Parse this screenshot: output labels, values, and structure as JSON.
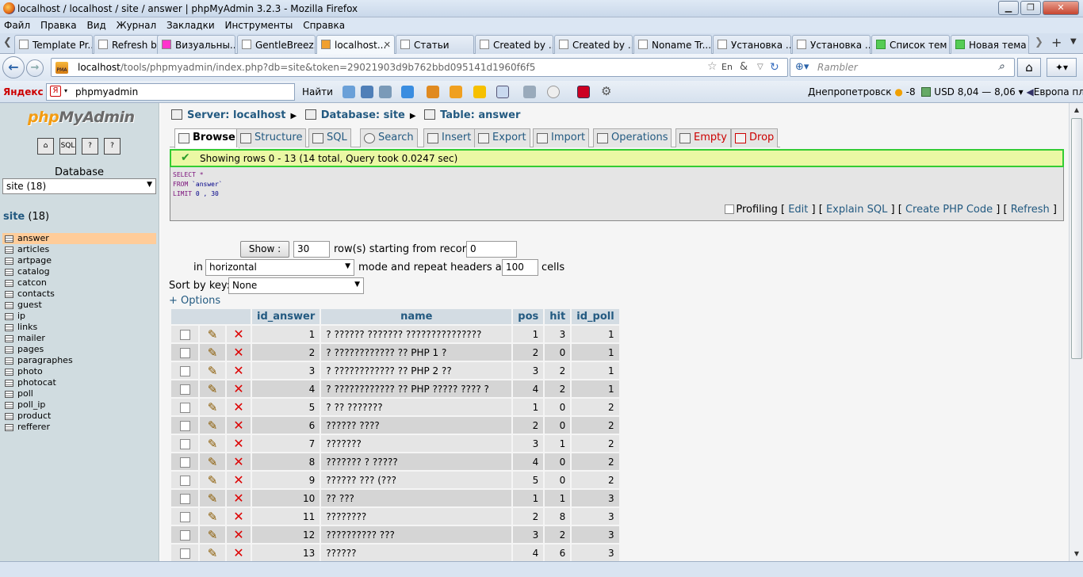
{
  "window": {
    "title": "localhost / localhost / site / answer | phpMyAdmin 3.2.3 - Mozilla Firefox"
  },
  "menu": [
    "Файл",
    "Правка",
    "Вид",
    "Журнал",
    "Закладки",
    "Инструменты",
    "Справка"
  ],
  "tabs": [
    {
      "label": "Template Pr..."
    },
    {
      "label": "Refresh by F..."
    },
    {
      "label": "Визуальны..."
    },
    {
      "label": "GentleBreez..."
    },
    {
      "label": "localhost..."
    },
    {
      "label": "Статьи"
    },
    {
      "label": "Created by ..."
    },
    {
      "label": "Created by ..."
    },
    {
      "label": "Noname Tr..."
    },
    {
      "label": "Установка ..."
    },
    {
      "label": "Установка ..."
    },
    {
      "label": "Список тем"
    },
    {
      "label": "Новая тема"
    }
  ],
  "nav": {
    "url_host": "localhost",
    "url_rest": "/tools/phpmyadmin/index.php?db=site&token=29021903d9b762bbd095141d1960f6f5",
    "search_placeholder": "Rambler"
  },
  "yandex": {
    "logo": "Яндекс",
    "search_value": "phpmyadmin",
    "find_label": "Найти",
    "city": "Днепропетровск",
    "temp": "-8",
    "usd": "USD 8,04 — 8,06",
    "radio": "Европа плюс"
  },
  "sidebar": {
    "logo_php": "php",
    "logo_my": "MyAdmin",
    "database_label": "Database",
    "db_select": "site (18)",
    "db_name": "site",
    "db_count": "(18)",
    "tables": [
      "answer",
      "articles",
      "artpage",
      "catalog",
      "catcon",
      "contacts",
      "guest",
      "ip",
      "links",
      "mailer",
      "pages",
      "paragraphes",
      "photo",
      "photocat",
      "poll",
      "poll_ip",
      "product",
      "refferer"
    ]
  },
  "breadcrumb": {
    "server": "Server: localhost",
    "database": "Database: site",
    "table": "Table: answer"
  },
  "main_tabs": [
    "Browse",
    "Structure",
    "SQL",
    "Search",
    "Insert",
    "Export",
    "Import",
    "Operations",
    "Empty",
    "Drop"
  ],
  "result": {
    "message": "Showing rows 0 - 13 (14 total, Query took 0.0247 sec)",
    "sql_select": "SELECT",
    "sql_star": "*",
    "sql_from": "FROM",
    "sql_table": "`answer`",
    "sql_limit": "LIMIT",
    "sql_limit_val": "0 , 30",
    "profiling": "Profiling",
    "edit": "Edit",
    "explain": "Explain SQL",
    "create_php": "Create PHP Code",
    "refresh": "Refresh"
  },
  "controls": {
    "show_button": "Show :",
    "rows": "30",
    "starting_label": "row(s) starting from record #",
    "start": "0",
    "in_label": "in",
    "mode": "horizontal",
    "mode_label": "mode and repeat headers after",
    "repeat": "100",
    "cells_label": "cells",
    "sortkey_label": "Sort by key:",
    "sortkey": "None",
    "options": "+ Options"
  },
  "table": {
    "headers": [
      "id_answer",
      "name",
      "pos",
      "hit",
      "id_poll"
    ],
    "rows": [
      [
        "1",
        "? ?????? ??????? ???????????????",
        "1",
        "3",
        "1"
      ],
      [
        "2",
        "? ???????????? ?? PHP 1 ?",
        "2",
        "0",
        "1"
      ],
      [
        "3",
        "? ???????????? ?? PHP 2 ??",
        "3",
        "2",
        "1"
      ],
      [
        "4",
        "? ???????????? ?? PHP ????? ???? ?",
        "4",
        "2",
        "1"
      ],
      [
        "5",
        "? ?? ???????",
        "1",
        "0",
        "2"
      ],
      [
        "6",
        "?????? ????",
        "2",
        "0",
        "2"
      ],
      [
        "7",
        "???????",
        "3",
        "1",
        "2"
      ],
      [
        "8",
        "??????? ? ?????",
        "4",
        "0",
        "2"
      ],
      [
        "9",
        "?????? ??? (???",
        "5",
        "0",
        "2"
      ],
      [
        "10",
        "?? ???",
        "1",
        "1",
        "3"
      ],
      [
        "11",
        "????????",
        "2",
        "8",
        "3"
      ],
      [
        "12",
        "?????????? ???",
        "3",
        "2",
        "3"
      ],
      [
        "13",
        "??????",
        "4",
        "6",
        "3"
      ]
    ]
  }
}
